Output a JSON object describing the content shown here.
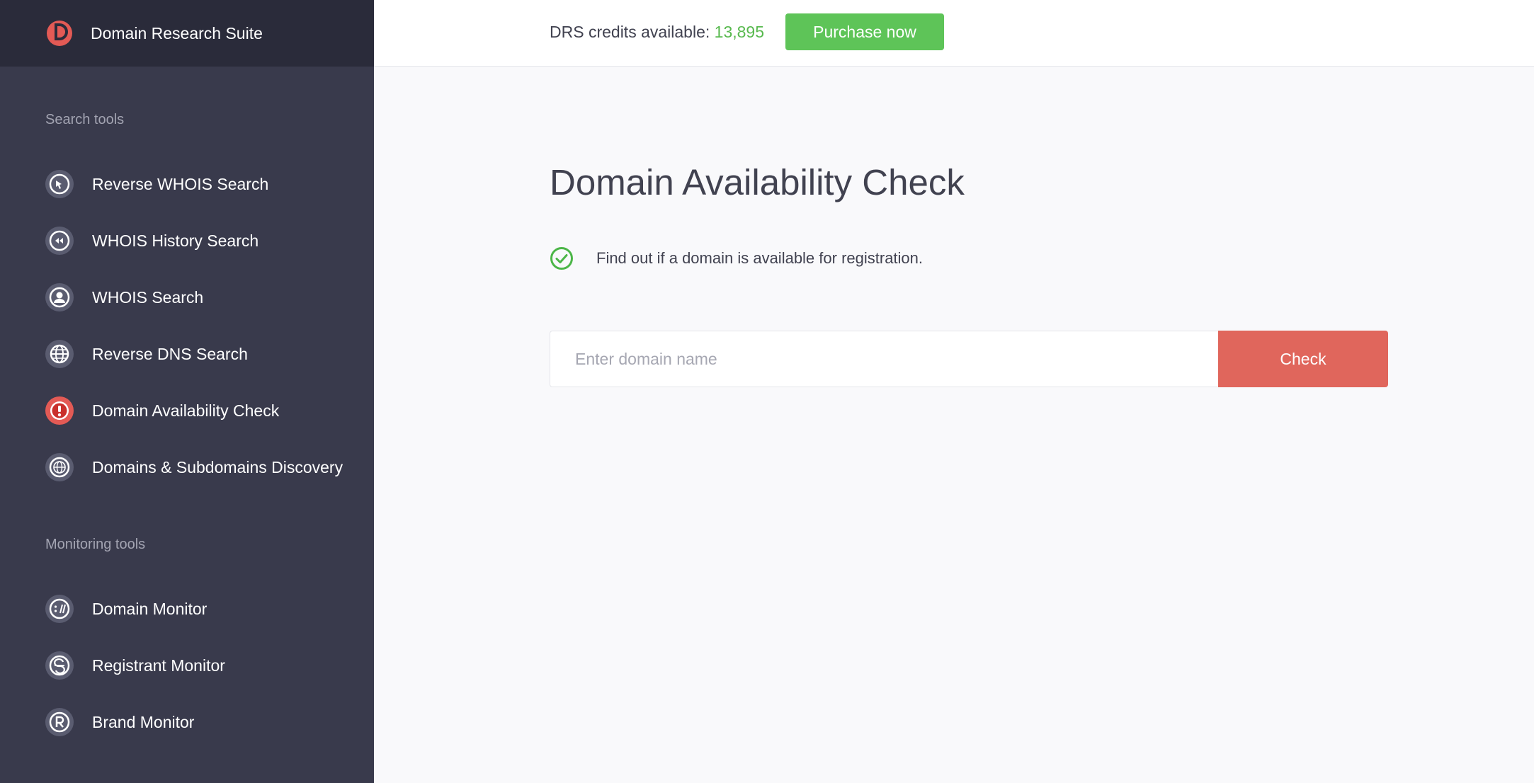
{
  "brand": {
    "name": "Domain Research Suite",
    "accent_color": "#e35a55"
  },
  "sidebar": {
    "sections": [
      {
        "label": "Search tools",
        "items": [
          {
            "label": "Reverse WHOIS Search",
            "icon": "reverse-whois-icon",
            "active": false
          },
          {
            "label": "WHOIS History Search",
            "icon": "rewind-icon",
            "active": false
          },
          {
            "label": "WHOIS Search",
            "icon": "user-icon",
            "active": false
          },
          {
            "label": "Reverse DNS Search",
            "icon": "globe-icon",
            "active": false
          },
          {
            "label": "Domain Availability Check",
            "icon": "exclamation-icon",
            "active": true
          },
          {
            "label": "Domains & Subdomains Discovery",
            "icon": "globe-grid-icon",
            "active": false
          }
        ]
      },
      {
        "label": "Monitoring tools",
        "items": [
          {
            "label": "Domain Monitor",
            "icon": "domain-monitor-icon",
            "active": false
          },
          {
            "label": "Registrant Monitor",
            "icon": "registrant-icon",
            "active": false
          },
          {
            "label": "Brand Monitor",
            "icon": "registered-icon",
            "active": false
          }
        ]
      }
    ]
  },
  "topbar": {
    "credits_label": "DRS credits available: ",
    "credits_value": "13,895",
    "purchase_label": "Purchase now",
    "purchase_color": "#5ec458"
  },
  "main": {
    "title": "Domain Availability Check",
    "subtitle": "Find out if a domain is available for registration.",
    "input": {
      "placeholder": "Enter domain name",
      "value": ""
    },
    "check_label": "Check",
    "check_color": "#e0665c"
  }
}
